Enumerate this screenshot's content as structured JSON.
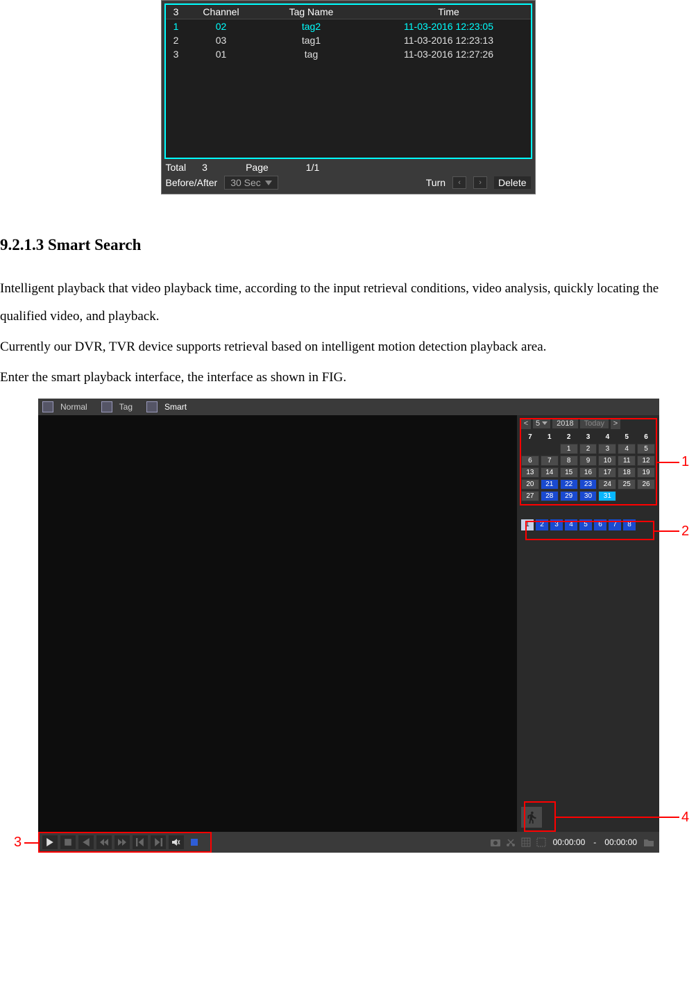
{
  "tag_panel": {
    "headers": {
      "idx": "3",
      "channel": "Channel",
      "tagname": "Tag Name",
      "time": "Time"
    },
    "rows": [
      {
        "idx": "1",
        "channel": "02",
        "tagname": "tag2",
        "time": "11-03-2016 12:23:05",
        "selected": true
      },
      {
        "idx": "2",
        "channel": "03",
        "tagname": "tag1",
        "time": "11-03-2016 12:23:13",
        "selected": false
      },
      {
        "idx": "3",
        "channel": "01",
        "tagname": "tag",
        "time": "11-03-2016 12:27:26",
        "selected": false
      }
    ],
    "footer": {
      "total_label": "Total",
      "total_value": "3",
      "page_label": "Page",
      "page_value": "1/1",
      "before_after_label": "Before/After",
      "before_after_value": "30 Sec",
      "turn_label": "Turn",
      "delete_label": "Delete"
    }
  },
  "doc": {
    "heading": "9.2.1.3 Smart Search",
    "p1": "Intelligent playback that video playback time, according to the input retrieval conditions, video analysis, quickly locating the qualified video, and playback.",
    "p2": "Currently our DVR, TVR device supports retrieval based on intelligent motion detection playback area.",
    "p3": "Enter the smart playback interface, the interface as shown in FIG."
  },
  "smart": {
    "tabs": {
      "normal": "Normal",
      "tag": "Tag",
      "smart": "Smart"
    },
    "calendar": {
      "month": "5",
      "year": "2018",
      "today_label": "Today",
      "dow": [
        "7",
        "1",
        "2",
        "3",
        "4",
        "5",
        "6"
      ],
      "cells": [
        {
          "t": "",
          "c": "blank"
        },
        {
          "t": "",
          "c": "blank"
        },
        {
          "t": "1",
          "c": ""
        },
        {
          "t": "2",
          "c": ""
        },
        {
          "t": "3",
          "c": ""
        },
        {
          "t": "4",
          "c": ""
        },
        {
          "t": "5",
          "c": ""
        },
        {
          "t": "6",
          "c": ""
        },
        {
          "t": "7",
          "c": ""
        },
        {
          "t": "8",
          "c": ""
        },
        {
          "t": "9",
          "c": ""
        },
        {
          "t": "10",
          "c": ""
        },
        {
          "t": "11",
          "c": ""
        },
        {
          "t": "12",
          "c": ""
        },
        {
          "t": "13",
          "c": ""
        },
        {
          "t": "14",
          "c": ""
        },
        {
          "t": "15",
          "c": ""
        },
        {
          "t": "16",
          "c": ""
        },
        {
          "t": "17",
          "c": ""
        },
        {
          "t": "18",
          "c": ""
        },
        {
          "t": "19",
          "c": ""
        },
        {
          "t": "20",
          "c": ""
        },
        {
          "t": "21",
          "c": "blue"
        },
        {
          "t": "22",
          "c": "blue"
        },
        {
          "t": "23",
          "c": "blue"
        },
        {
          "t": "24",
          "c": ""
        },
        {
          "t": "25",
          "c": ""
        },
        {
          "t": "26",
          "c": ""
        },
        {
          "t": "27",
          "c": ""
        },
        {
          "t": "28",
          "c": "blue"
        },
        {
          "t": "29",
          "c": "blue"
        },
        {
          "t": "30",
          "c": "blue"
        },
        {
          "t": "31",
          "c": "cur"
        },
        {
          "t": "",
          "c": "blank"
        },
        {
          "t": "",
          "c": "blank"
        }
      ]
    },
    "channels": [
      "1",
      "2",
      "3",
      "4",
      "5",
      "6",
      "7",
      "8"
    ],
    "time": {
      "start": "00:00:00",
      "sep": "-",
      "end": "00:00:00"
    }
  },
  "callouts": {
    "c1": "1",
    "c2": "2",
    "c3": "3",
    "c4": "4"
  }
}
